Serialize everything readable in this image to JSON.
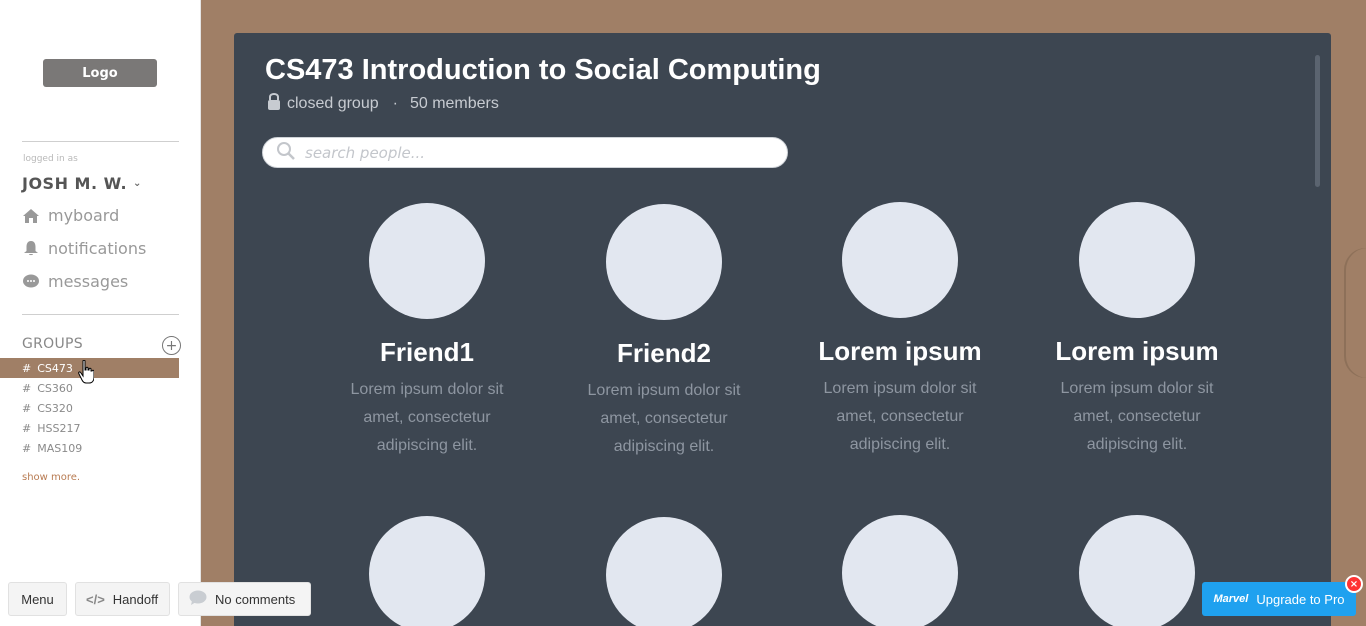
{
  "sidebar": {
    "logo": "Logo",
    "logged_label": "logged in as",
    "user": "JOSH M. W.",
    "nav": [
      {
        "label": "myboard",
        "icon": "home-icon"
      },
      {
        "label": "notifications",
        "icon": "bell-icon"
      },
      {
        "label": "messages",
        "icon": "chat-icon"
      }
    ],
    "groups_title": "GROUPS",
    "groups": [
      "CS473",
      "CS360",
      "CS320",
      "HSS217",
      "MAS109"
    ],
    "active_group": "CS473",
    "show_more": "show more.",
    "hash": "#"
  },
  "main": {
    "title": "CS473 Introduction to Social Computing",
    "privacy": "closed group",
    "members": "50 members",
    "search_placeholder": "search people...",
    "cards": [
      {
        "name": "Friend1",
        "desc": "Lorem ipsum dolor sit amet, consectetur adipiscing elit."
      },
      {
        "name": "Friend2",
        "desc": "Lorem ipsum dolor sit amet, consectetur adipiscing elit."
      },
      {
        "name": "Lorem ipsum",
        "desc": "Lorem ipsum dolor sit amet, consectetur adipiscing elit."
      },
      {
        "name": "Lorem ipsum",
        "desc": "Lorem ipsum dolor sit amet, consectetur adipiscing elit."
      }
    ]
  },
  "toolbar": {
    "menu": "Menu",
    "handoff": "Handoff",
    "comments": "No comments",
    "upgrade_brand": "Marvel",
    "upgrade": "Upgrade to Pro",
    "close": "×"
  },
  "colors": {
    "background": "#a07f66",
    "panel": "#3d4651",
    "avatar": "#e2e7f0",
    "accent": "#1fa1ef"
  }
}
